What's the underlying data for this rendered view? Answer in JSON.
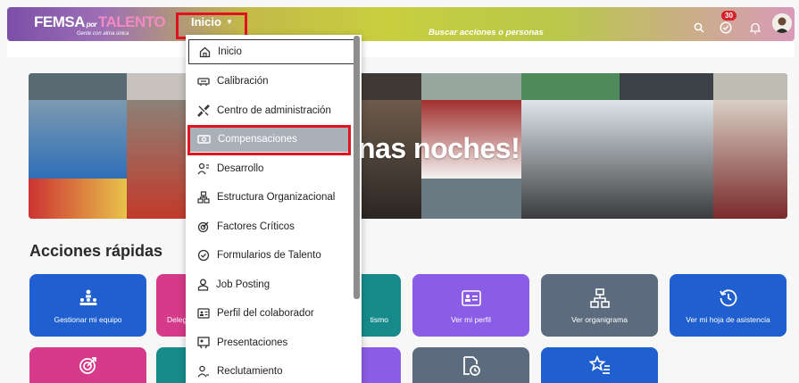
{
  "header": {
    "logo_main": "FEMSA",
    "logo_accent": "TALENTO",
    "logo_sub": "Gente con alma única",
    "nav_label": "Inicio",
    "search_placeholder": "Buscar acciones o personas",
    "notification_count": "30"
  },
  "banner": {
    "greeting": "nas noches!"
  },
  "quick_actions": {
    "title": "Acciones rápidas",
    "cards": [
      {
        "label": "Gestionar mi equipo",
        "color": "#1f5fcf",
        "icon": "team-icon"
      },
      {
        "label": "Deleg",
        "color": "#d63a8a",
        "icon": "delegate-icon"
      },
      {
        "label": "tismo",
        "color": "#178b8b",
        "icon": "absence-icon"
      },
      {
        "label": "Ver mi perfil",
        "color": "#8b5ce6",
        "icon": "profile-card-icon"
      },
      {
        "label": "Ver organigrama",
        "color": "#5c6c7e",
        "icon": "org-chart-icon"
      },
      {
        "label": "Ver mi hoja de asistencia",
        "color": "#1f5fcf",
        "icon": "history-icon"
      }
    ],
    "row2_colors": [
      "#d63a8a",
      "#178b8b",
      "#8b5ce6",
      "#5c6c7e",
      "#1f5fcf"
    ]
  },
  "menu": {
    "items": [
      {
        "label": "Inicio",
        "icon": "home-icon"
      },
      {
        "label": "Calibración",
        "icon": "calibration-icon"
      },
      {
        "label": "Centro de administración",
        "icon": "admin-wrench-icon"
      },
      {
        "label": "Compensaciones",
        "icon": "compensation-icon"
      },
      {
        "label": "Desarrollo",
        "icon": "development-icon"
      },
      {
        "label": "Estructura Organizacional",
        "icon": "org-structure-icon"
      },
      {
        "label": "Factores Críticos",
        "icon": "target-icon"
      },
      {
        "label": "Formularios de Talento",
        "icon": "form-icon"
      },
      {
        "label": "Job Posting",
        "icon": "job-posting-icon"
      },
      {
        "label": "Perfil del colaborador",
        "icon": "profile-icon"
      },
      {
        "label": "Presentaciones",
        "icon": "presentation-icon"
      },
      {
        "label": "Reclutamiento",
        "icon": "recruiting-icon"
      }
    ]
  }
}
